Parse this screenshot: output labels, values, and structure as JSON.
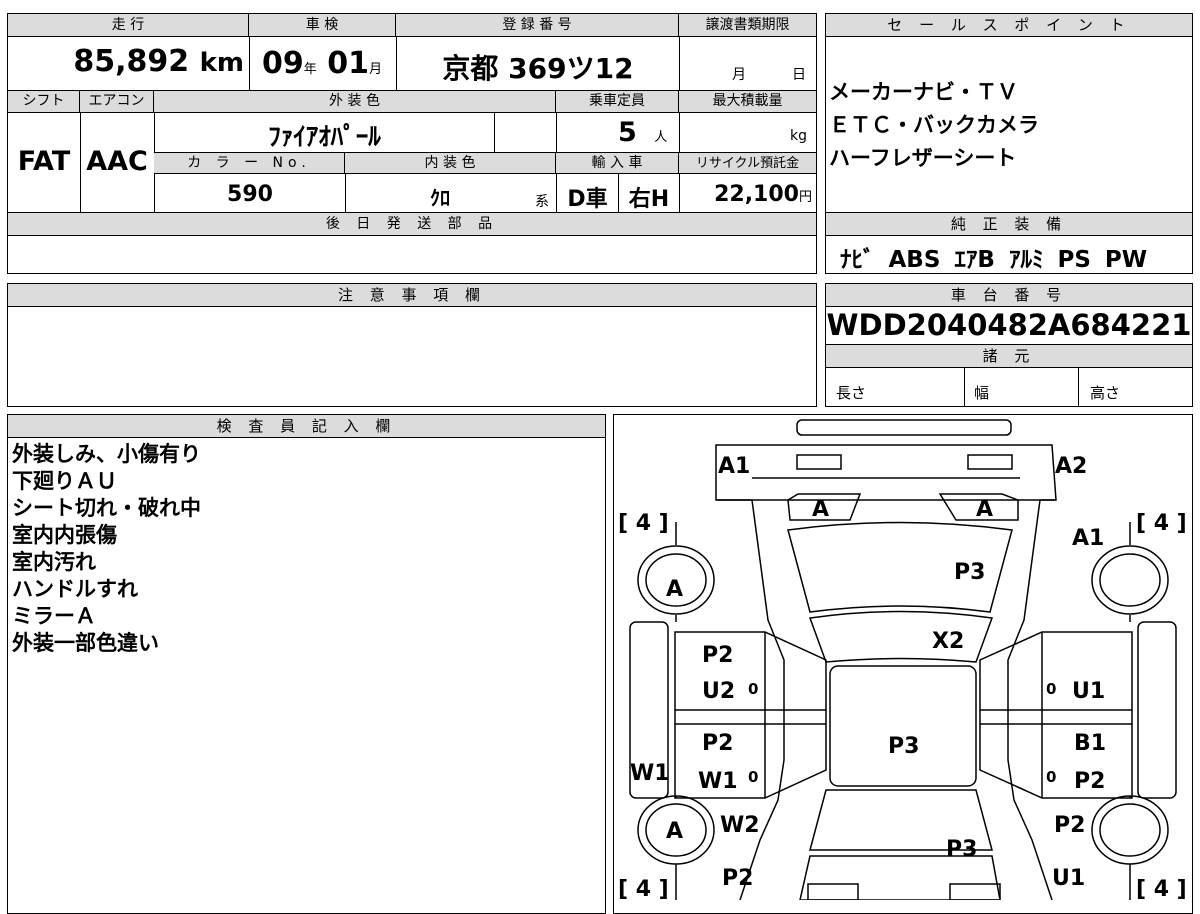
{
  "top": {
    "h_mileage": "走 行",
    "h_inspection": "車 検",
    "h_registration": "登 録 番 号",
    "h_transfer_deadline": "譲渡書類期限",
    "mileage": "85,892",
    "mileage_unit": "km",
    "insp_year": "09",
    "insp_year_unit": "年",
    "insp_month": "01",
    "insp_month_unit": "月",
    "registration": "京都 369ツ12",
    "deadline_month_unit": "月",
    "deadline_day_unit": "日"
  },
  "mid": {
    "h_shift": "シフト",
    "h_aircon": "エアコン",
    "h_exterior_color": "外 装 色",
    "h_capacity": "乗車定員",
    "h_max_load": "最大積載量",
    "shift": "FAT",
    "aircon": "AAC",
    "exterior_color": "ﾌｧｲｱｵﾊﾟｰﾙ",
    "capacity": "5",
    "capacity_unit": "人",
    "max_load_unit": "kg",
    "h_color_no": "カ ラ ー No.",
    "h_interior_color": "内 装 色",
    "h_import": "輸 入 車",
    "h_recycle": "リサイクル預託金",
    "color_no": "590",
    "interior_color": "ｸﾛ",
    "interior_suffix": "系",
    "import_type": "D車",
    "steering": "右H",
    "recycle": "22,100",
    "recycle_unit": "円",
    "h_later_parts": "後 日 発 送 部 品"
  },
  "sales": {
    "h_sales": "セ ー ル ス ポ イ ン ト",
    "lines": [
      "メーカーナビ・ＴＶ",
      "ＥＴＣ・バックカメラ",
      "ハーフレザーシート"
    ],
    "h_equipment": "純 正 装 備",
    "equipment": "ﾅﾋﾞ ABS ｴｱB ｱﾙﾐ PS PW"
  },
  "notice": {
    "h_notice": "注 意 事 項 欄"
  },
  "chassis": {
    "h_chassis": "車 台 番 号",
    "chassis_no": "WDD2040482A684221",
    "h_specs": "諸 元",
    "length": "長さ",
    "width": "幅",
    "height": "高さ"
  },
  "inspector": {
    "h_inspector": "検 査 員 記 入 欄",
    "lines": [
      "外装しみ、小傷有り",
      "下廻りＡＵ",
      "シート切れ・破れ中",
      "室内内張傷",
      "室内汚れ",
      "ハンドルすれ",
      "ミラーＡ",
      "外装一部色違い"
    ]
  },
  "diagram": {
    "bracket_tl": "[ 4 ]",
    "bracket_tr": "[ 4 ]",
    "bracket_bl": "[ 4 ]",
    "bracket_br": "[ 4 ]",
    "labels": {
      "a1_left": "A1",
      "a2_right": "A2",
      "a_front_left": "A",
      "a_front_right": "A",
      "a1_right_side": "A1",
      "p3_hood": "P3",
      "a_wheel_fl": "A",
      "x2_windshield": "X2",
      "p2_left_front": "P2",
      "u2_left_front": "U2",
      "u1_right_front": "U1",
      "p3_roof": "P3",
      "p2_left_rear": "P2",
      "b1_right": "B1",
      "w1_left_side": "W1",
      "w1_left_door": "W1",
      "p2_right_door": "P2",
      "a_wheel_rl": "A",
      "w2_left": "W2",
      "p2_right_rear": "P2",
      "p3_trunk": "P3",
      "p2_left_bottom": "P2",
      "u1_right_bottom": "U1",
      "zero_1": "0",
      "zero_2": "0",
      "zero_3": "0",
      "zero_4": "0"
    }
  }
}
